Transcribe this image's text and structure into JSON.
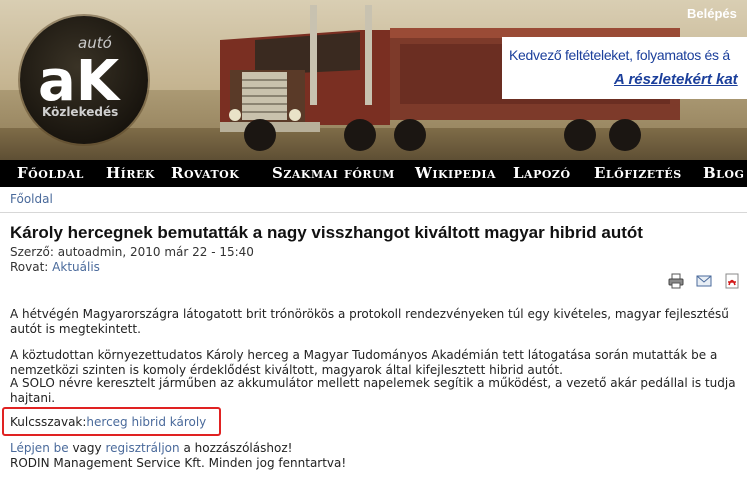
{
  "header": {
    "logo": {
      "top_text": "autó",
      "main_text": "aK",
      "bottom_text": "Közlekedés"
    },
    "login_label": "Belépés",
    "ad": {
      "line1": "Kedvező feltételeket, folyamatos és á",
      "line2": "A részletekért kat"
    }
  },
  "nav": {
    "items": [
      {
        "label": "Főoldal"
      },
      {
        "label": "Hírek"
      },
      {
        "label": "Rovatok"
      },
      {
        "label": "Szakmai fórum"
      },
      {
        "label": "Wikipedia"
      },
      {
        "label": "Lapozó"
      },
      {
        "label": "Előfizetés"
      },
      {
        "label": "Blog"
      }
    ]
  },
  "breadcrumb": "Főoldal",
  "article": {
    "title": "Károly hercegnek bemutatták a nagy visszhangot kiváltott magyar hibrid autót",
    "author_label": "Szerző:",
    "author": "autoadmin, 2010 már 22 - 15:40",
    "section_label": "Rovat:",
    "section": "Aktuális",
    "paragraphs": [
      "A hétvégén Magyarországra látogatott brit trónörökös a protokoll rendezvényeken túl egy kivételes, magyar fejlesztésű autót is megtekintett.",
      "A köztudottan környezettudatos Károly herceg a Magyar Tudományos Akadémián tett látogatása során mutatták be a nemzetközi szinten is komoly érdeklődést kiváltott, magyarok által kifejlesztett hibrid autót.",
      "A SOLO névre keresztelt járműben az akkumulátor mellett napelemek segítik a működést, a vezető akár pedállal is tudja hajtani."
    ],
    "keywords_label": "Kulcsszavak:",
    "keywords": "herceg hibrid károly"
  },
  "tools": {
    "icons": [
      "print-icon",
      "email-icon",
      "pdf-icon"
    ]
  },
  "footer": {
    "login_link": "Lépjen be",
    "or_text": "vagy",
    "register_link": "regisztráljon",
    "comment_text": "a hozzászóláshoz!",
    "copyright": "RODIN Management Service Kft. Minden jog fenntartva!"
  },
  "colors": {
    "nav_bg": "#000000",
    "link": "#4a6a9b",
    "ad_text": "#1b3f9b",
    "highlight_border": "#e02222"
  }
}
